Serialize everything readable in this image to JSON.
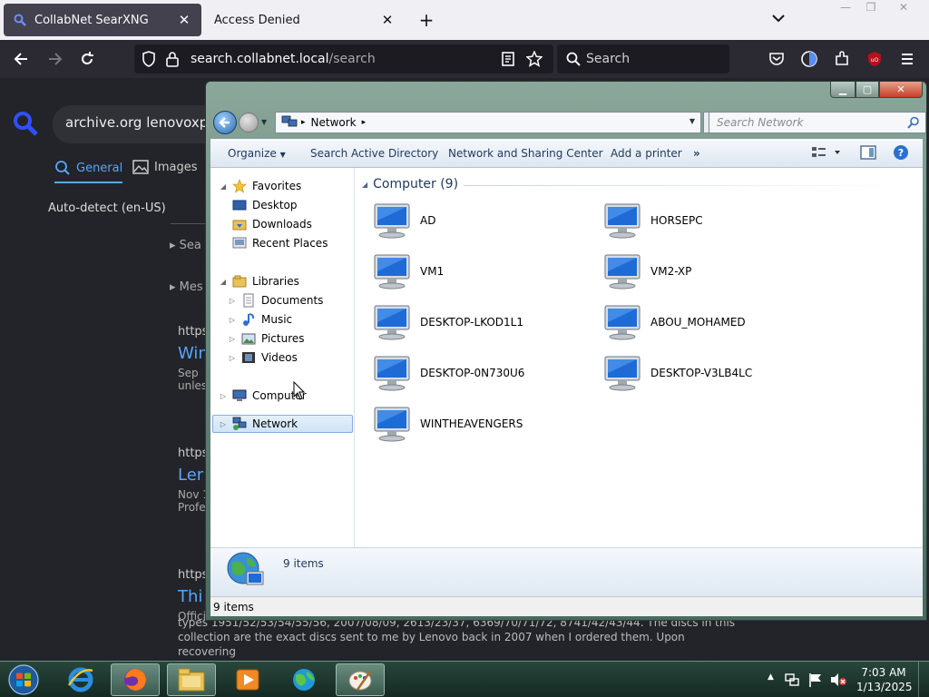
{
  "browser": {
    "tabs": [
      {
        "title": "CollabNet SearXNG",
        "active": true
      },
      {
        "title": "Access Denied",
        "active": false
      }
    ],
    "url_domain": "search.collabnet.local",
    "url_path": "/search",
    "search_placeholder": "Search"
  },
  "searx": {
    "query": "archive.org lenovoxp",
    "tab_general": "General",
    "tab_images": "Images",
    "language": "Auto-detect (en-US)",
    "truncated": [
      "Sea",
      "Mes"
    ],
    "results": [
      {
        "url": "https:",
        "title": "Win",
        "line1": "Sep",
        "line2": "unles"
      },
      {
        "url": "https:",
        "title": "Ler",
        "line1": "Nov 1",
        "line2": "Profe"
      },
      {
        "url": "https:",
        "title": "Thi",
        "line1": "Offici"
      }
    ],
    "snippet_line1": "types 1951/52/53/54/55/56, 2007/08/09, 2613/23/37, 6369/70/71/72, 8741/42/43/44. The discs in this",
    "snippet_line2": "collection are the exact discs sent to me by Lenovo back in 2007 when I ordered them. Upon recovering"
  },
  "explorer": {
    "address": "Network",
    "search_placeholder": "Search Network",
    "toolbar": {
      "organize": "Organize",
      "search_ad": "Search Active Directory",
      "net_sharing": "Network and Sharing Center",
      "add_printer": "Add a printer",
      "more": "»"
    },
    "nav": {
      "favorites": "Favorites",
      "desktop": "Desktop",
      "downloads": "Downloads",
      "recent": "Recent Places",
      "libraries": "Libraries",
      "documents": "Documents",
      "music": "Music",
      "pictures": "Pictures",
      "videos": "Videos",
      "computer": "Computer",
      "network": "Network"
    },
    "group_header": "Computer (9)",
    "computers": [
      "AD",
      "HORSEPC",
      "VM1",
      "VM2-XP",
      "DESKTOP-LKOD1L1",
      "ABOU_MOHAMED",
      "DESKTOP-0N730U6",
      "DESKTOP-V3LB4LC",
      "WINTHEAVENGERS"
    ],
    "details_count": "9 items",
    "status_count": "9 items"
  },
  "taskbar": {
    "time": "7:03 AM",
    "date": "1/13/2025"
  }
}
